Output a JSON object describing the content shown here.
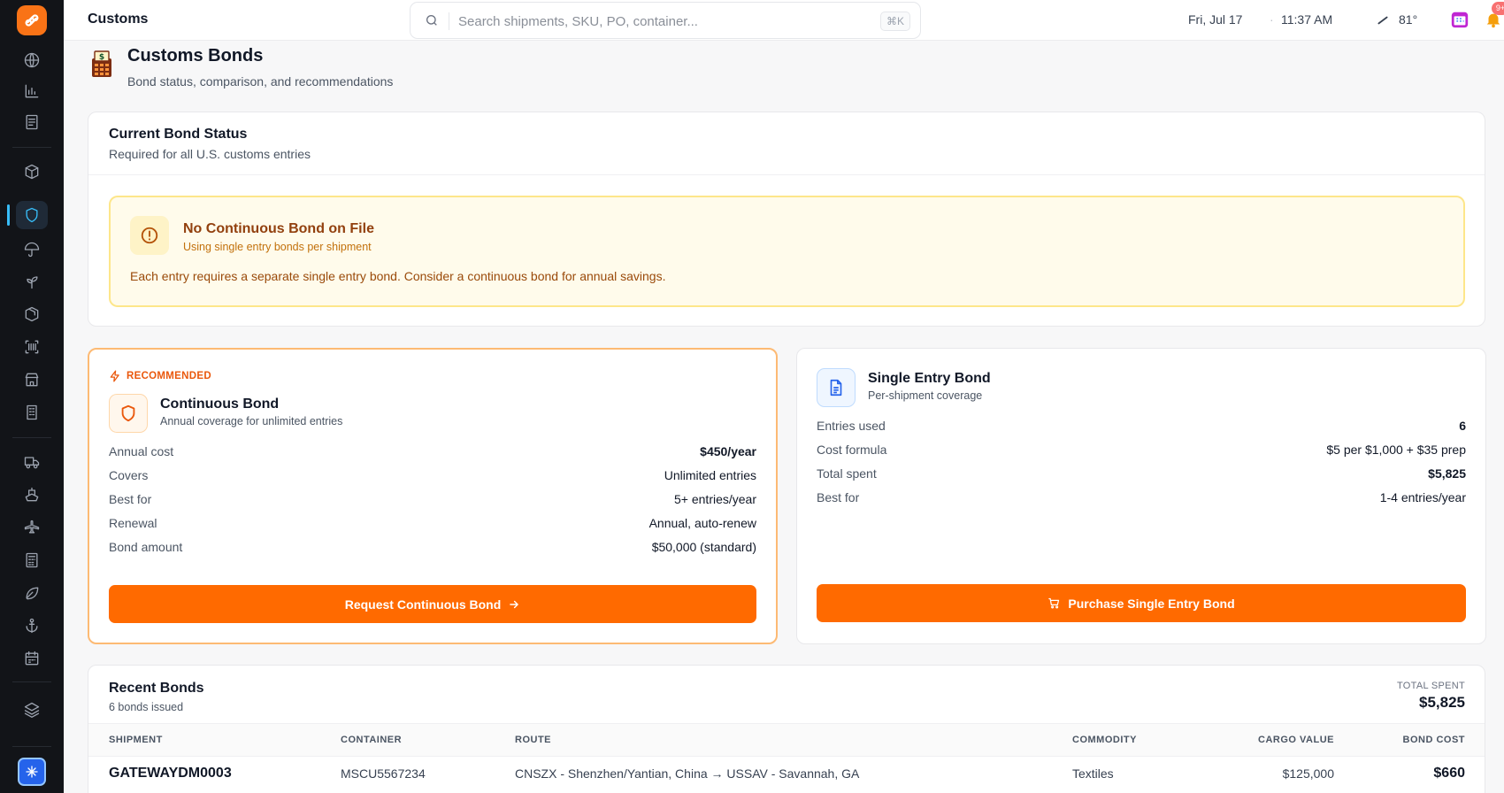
{
  "app": {
    "page_label": "Customs"
  },
  "topbar": {
    "search_placeholder": "Search shipments, SKU, PO, container...",
    "shortcut": "⌘K",
    "date": "Fri, Jul 17",
    "separator": "·",
    "time": "11:37 AM",
    "weather": "81°",
    "notification_badge": "9+"
  },
  "header": {
    "title": "Customs Bonds",
    "subtitle": "Bond status, comparison, and recommendations"
  },
  "status": {
    "title": "Current Bond Status",
    "subtitle": "Required for all U.S. customs entries",
    "alert_title": "No Continuous Bond on File",
    "alert_subtitle": "Using single entry bonds per shipment",
    "alert_body": "Each entry requires a separate single entry bond. Consider a continuous bond for annual savings."
  },
  "continuous": {
    "tag": "RECOMMENDED",
    "name": "Continuous Bond",
    "desc": "Annual coverage for unlimited entries",
    "rows": [
      {
        "label": "Annual cost",
        "value": "$450/year"
      },
      {
        "label": "Covers",
        "value": "Unlimited entries"
      },
      {
        "label": "Best for",
        "value": "5+ entries/year"
      },
      {
        "label": "Renewal",
        "value": "Annual, auto-renew"
      },
      {
        "label": "Bond amount",
        "value": "$50,000 (standard)"
      }
    ],
    "button": "Request Continuous Bond"
  },
  "single": {
    "name": "Single Entry Bond",
    "desc": "Per-shipment coverage",
    "rows": [
      {
        "label": "Entries used",
        "value": "6"
      },
      {
        "label": "Cost formula",
        "value": "$5 per $1,000 + $35 prep"
      },
      {
        "label": "Total spent",
        "value": "$5,825"
      },
      {
        "label": "Best for",
        "value": "1-4 entries/year"
      }
    ],
    "button": "Purchase Single Entry Bond"
  },
  "recent": {
    "title": "Recent Bonds",
    "subtitle": "6 bonds issued",
    "total_label": "TOTAL SPENT",
    "total_value": "$5,825",
    "columns": [
      "SHIPMENT",
      "CONTAINER",
      "ROUTE",
      "COMMODITY",
      "CARGO VALUE",
      "BOND COST"
    ],
    "rows": [
      {
        "shipment": "GATEWAYDM0003",
        "container": "MSCU5567234",
        "route": "CNSZX - Shenzhen/Yantian, China → USSAV - Savannah, GA",
        "commodity": "Textiles",
        "cargo_value": "$125,000",
        "bond_cost": "$660"
      }
    ]
  },
  "colors": {
    "accent": "#ff6a00",
    "sidebar_bg": "#121418",
    "active_icon": "#38bdf8",
    "alert_bg": "#fffbeb",
    "alert_border": "#fde68a"
  },
  "icons": {
    "sidebar": [
      "globe-icon",
      "chart-icon",
      "document-icon",
      "box-icon",
      "shield-icon",
      "umbrella-icon",
      "sprout-icon",
      "package-icon",
      "barcode-icon",
      "store-icon",
      "building-icon",
      "truck-icon",
      "ship-icon",
      "plane-icon",
      "calculator-icon",
      "leaf-icon",
      "anchor-icon",
      "calendar-icon",
      "layers-icon"
    ]
  }
}
